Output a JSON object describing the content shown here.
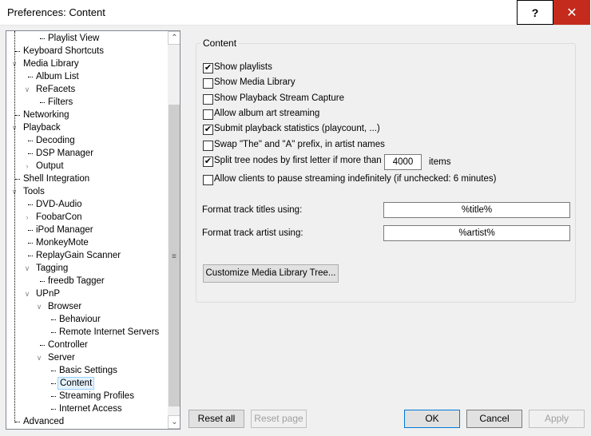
{
  "window": {
    "title": "Preferences: Content",
    "help": "?",
    "close": "✕"
  },
  "tree": [
    {
      "label": "Playlist View",
      "level": 2
    },
    {
      "label": "Keyboard Shortcuts",
      "level": 0
    },
    {
      "label": "Media Library",
      "level": 0,
      "expander": "expanded"
    },
    {
      "label": "Album List",
      "level": 1
    },
    {
      "label": "ReFacets",
      "level": 1,
      "expander": "expanded"
    },
    {
      "label": "Filters",
      "level": 2
    },
    {
      "label": "Networking",
      "level": 0
    },
    {
      "label": "Playback",
      "level": 0,
      "expander": "expanded"
    },
    {
      "label": "Decoding",
      "level": 1
    },
    {
      "label": "DSP Manager",
      "level": 1
    },
    {
      "label": "Output",
      "level": 1,
      "expander": "collapsed"
    },
    {
      "label": "Shell Integration",
      "level": 0
    },
    {
      "label": "Tools",
      "level": 0,
      "expander": "expanded"
    },
    {
      "label": "DVD-Audio",
      "level": 1
    },
    {
      "label": "FoobarCon",
      "level": 1,
      "expander": "collapsed"
    },
    {
      "label": "iPod Manager",
      "level": 1
    },
    {
      "label": "MonkeyMote",
      "level": 1
    },
    {
      "label": "ReplayGain Scanner",
      "level": 1
    },
    {
      "label": "Tagging",
      "level": 1,
      "expander": "expanded"
    },
    {
      "label": "freedb Tagger",
      "level": 2
    },
    {
      "label": "UPnP",
      "level": 1,
      "expander": "expanded"
    },
    {
      "label": "Browser",
      "level": 2,
      "expander": "expanded"
    },
    {
      "label": "Behaviour",
      "level": 3
    },
    {
      "label": "Remote Internet Servers",
      "level": 3
    },
    {
      "label": "Controller",
      "level": 2
    },
    {
      "label": "Server",
      "level": 2,
      "expander": "expanded"
    },
    {
      "label": "Basic Settings",
      "level": 3
    },
    {
      "label": "Content",
      "level": 3,
      "selected": true
    },
    {
      "label": "Streaming Profiles",
      "level": 3
    },
    {
      "label": "Internet Access",
      "level": 3
    },
    {
      "label": "Advanced",
      "level": 0
    }
  ],
  "content": {
    "group_label": "Content",
    "checkboxes": [
      {
        "label": "Show playlists",
        "checked": true
      },
      {
        "label": "Show Media Library",
        "checked": false
      },
      {
        "label": "Show Playback Stream Capture",
        "checked": false
      },
      {
        "label": "Allow album art streaming",
        "checked": false
      },
      {
        "label": "Submit playback statistics (playcount, ...)",
        "checked": true
      },
      {
        "label": "Swap \"The\" and \"A\" prefix, in artist names",
        "checked": false
      },
      {
        "label": "Split tree nodes by first letter if more than",
        "checked": true
      },
      {
        "label": "Allow clients to pause streaming indefinitely (if unchecked: 6 minutes)",
        "checked": false
      }
    ],
    "split_value": "4000",
    "split_suffix": "items",
    "title_format_label": "Format track titles using:",
    "title_format_value": "%title%",
    "artist_format_label": "Format track artist using:",
    "artist_format_value": "%artist%",
    "customize_button": "Customize Media Library Tree..."
  },
  "buttons": {
    "reset_all": "Reset all",
    "reset_page": "Reset page",
    "ok": "OK",
    "cancel": "Cancel",
    "apply": "Apply"
  }
}
